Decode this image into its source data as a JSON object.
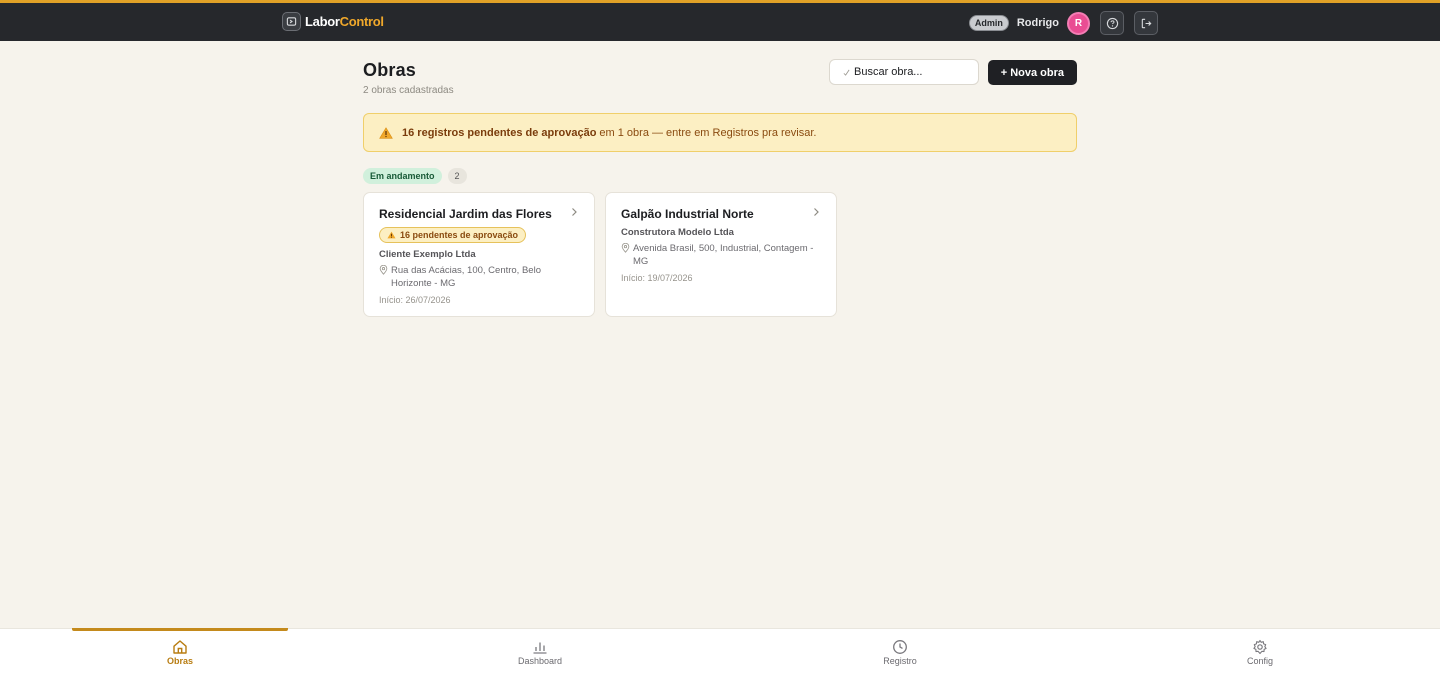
{
  "header": {
    "brand_part1": "Labor",
    "brand_part2": "Control",
    "role_badge": "Admin",
    "user_name": "Rodrigo",
    "avatar_initial": "R"
  },
  "page": {
    "title": "Obras",
    "subtitle": "2 obras cadastradas",
    "search_placeholder": "Buscar obra...",
    "new_button": "+ Nova obra"
  },
  "alert": {
    "bold": "16 registros pendentes de aprovação",
    "rest": "em 1 obra — entre em Registros pra revisar."
  },
  "status_group": {
    "label": "Em andamento",
    "count": "2"
  },
  "cards": [
    {
      "title": "Residencial Jardim das Flores",
      "pending": "16 pendentes de aprovação",
      "client": "Cliente Exemplo Ltda",
      "address": "Rua das Acácias, 100, Centro, Belo Horizonte - MG",
      "start": "Início: 26/07/2026"
    },
    {
      "title": "Galpão Industrial Norte",
      "client": "Construtora Modelo Ltda",
      "address": "Avenida Brasil, 500, Industrial, Contagem - MG",
      "start": "Início: 19/07/2026"
    }
  ],
  "bottom_nav": [
    {
      "label": "Obras",
      "icon": "home-icon",
      "active": true
    },
    {
      "label": "Dashboard",
      "icon": "bar-chart-icon"
    },
    {
      "label": "Registro",
      "icon": "clock-icon"
    },
    {
      "label": "Config",
      "icon": "gear-icon"
    }
  ],
  "colors": {
    "accent": "#c48a1c",
    "header_bg": "#26282c",
    "page_bg": "#f6f3ec",
    "alert_bg": "#fcefc3",
    "status_green": "#d1f0dc",
    "avatar": "#e94d93"
  }
}
